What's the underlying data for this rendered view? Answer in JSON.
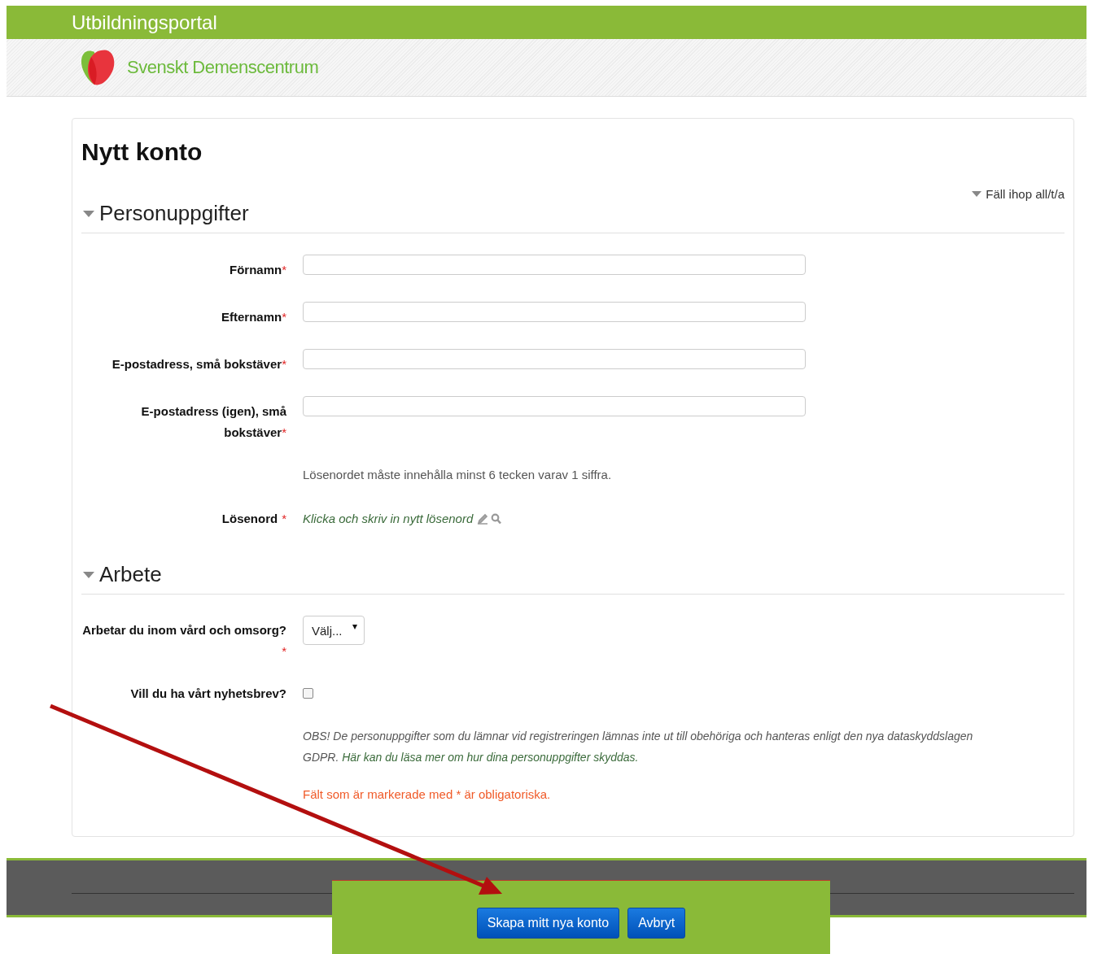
{
  "header": {
    "title": "Utbildningsportal",
    "brand": "Svenskt Demenscentrum"
  },
  "page_title": "Nytt konto",
  "collapse_link": "Fäll ihop all/t/a",
  "sections": [
    {
      "title": "Personuppgifter",
      "expanded": true,
      "fields": [
        {
          "kind": "text",
          "label": "Förnamn",
          "required_mark": "*"
        },
        {
          "kind": "text",
          "label": "Efternamn",
          "required_mark": "*"
        },
        {
          "kind": "text",
          "label": "E-postadress, små bokstäver",
          "required_mark": "*"
        },
        {
          "kind": "text",
          "label": "E-postadress (igen), små bokstäver",
          "required_mark": "*"
        },
        {
          "kind": "note",
          "text": "Lösenordet måste innehålla minst 6 tecken varav 1 siffra."
        },
        {
          "kind": "password",
          "label": "Lösenord",
          "required_mark": "*",
          "placeholder": "Klicka och skriv in nytt lösenord"
        }
      ]
    },
    {
      "title": "Arbete",
      "expanded": true,
      "fields": [
        {
          "kind": "select",
          "label": "Arbetar du inom vård och omsorg?",
          "required_mark": "*",
          "value": "Välj..."
        },
        {
          "kind": "checkbox",
          "label": "Vill du ha vårt nyhetsbrev?",
          "checked": false
        }
      ]
    }
  ],
  "privacy_note": {
    "text": "OBS! De personuppgifter som du lämnar vid registreringen lämnas inte ut till obehöriga och hanteras enligt den nya dataskyddslagen GDPR. ",
    "link": "Här kan du läsa mer om hur dina personuppgifter skyddas."
  },
  "required_note": "Fält som är markerade med * är obligatoriska.",
  "buttons": [
    {
      "label": "Skapa mitt nya konto"
    },
    {
      "label": "Avbryt"
    }
  ]
}
